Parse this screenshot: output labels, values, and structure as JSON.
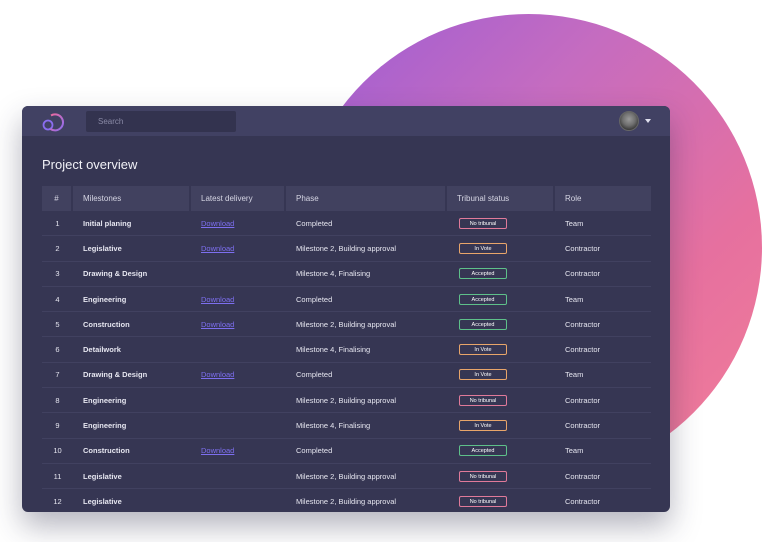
{
  "search": {
    "placeholder": "Search"
  },
  "page": {
    "title": "Project overview"
  },
  "table": {
    "headers": [
      "#",
      "Milestones",
      "Latest delivery",
      "Phase",
      "Tribunal status",
      "Role"
    ],
    "rows": [
      {
        "num": "1",
        "milestone": "Initial planing",
        "delivery": "Download",
        "phase": "Completed",
        "status": "No tribunal",
        "role": "Team"
      },
      {
        "num": "2",
        "milestone": "Legislative",
        "delivery": "Download",
        "phase": "Milestone 2, Building approval",
        "status": "In Vote",
        "role": "Contractor"
      },
      {
        "num": "3",
        "milestone": "Drawing & Design",
        "delivery": "",
        "phase": "Milestone 4, Finalising",
        "status": "Accepted",
        "role": "Contractor"
      },
      {
        "num": "4",
        "milestone": "Engineering",
        "delivery": "Download",
        "phase": "Completed",
        "status": "Accepted",
        "role": "Team"
      },
      {
        "num": "5",
        "milestone": "Construction",
        "delivery": "Download",
        "phase": "Milestone 2, Building approval",
        "status": "Accepted",
        "role": "Contractor"
      },
      {
        "num": "6",
        "milestone": "Detailwork",
        "delivery": "",
        "phase": "Milestone 4, Finalising",
        "status": "In Vote",
        "role": "Contractor"
      },
      {
        "num": "7",
        "milestone": "Drawing & Design",
        "delivery": "Download",
        "phase": "Completed",
        "status": "In Vote",
        "role": "Team"
      },
      {
        "num": "8",
        "milestone": "Engineering",
        "delivery": "",
        "phase": "Milestone 2, Building approval",
        "status": "No tribunal",
        "role": "Contractor"
      },
      {
        "num": "9",
        "milestone": "Engineering",
        "delivery": "",
        "phase": "Milestone 4, Finalising",
        "status": "In Vote",
        "role": "Contractor"
      },
      {
        "num": "10",
        "milestone": "Construction",
        "delivery": "Download",
        "phase": "Completed",
        "status": "Accepted",
        "role": "Team"
      },
      {
        "num": "11",
        "milestone": "Legislative",
        "delivery": "",
        "phase": "Milestone 2, Building approval",
        "status": "No tribunal",
        "role": "Contractor"
      },
      {
        "num": "12",
        "milestone": "Legislative",
        "delivery": "",
        "phase": "Milestone 2, Building approval",
        "status": "No tribunal",
        "role": "Contractor"
      }
    ]
  },
  "status_colors": {
    "No tribunal": "#e07a9a",
    "In Vote": "#e8a56a",
    "Accepted": "#5ec08a"
  },
  "colors": {
    "accent": "#7d6ff0",
    "card": "#363653",
    "topbar": "#414163"
  }
}
